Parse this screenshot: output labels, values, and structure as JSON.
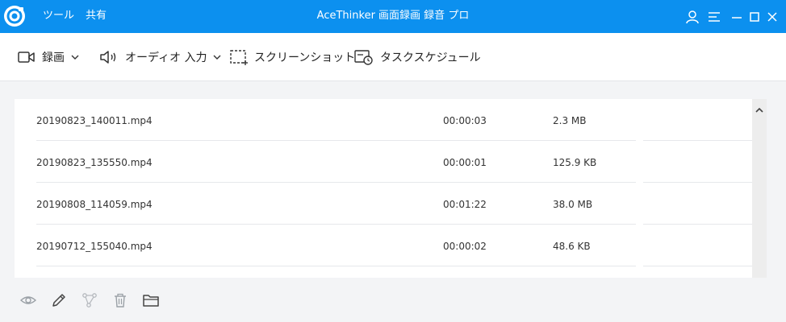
{
  "titlebar": {
    "menu": [
      "ツール",
      "共有"
    ],
    "title": "AceThinker 画面録画 録音 プロ",
    "icons": [
      "user-icon",
      "menu-icon",
      "minimize-icon",
      "maximize-icon",
      "close-icon"
    ]
  },
  "toolbar": {
    "record_label": "録画",
    "audio_label": "オーディオ 入力",
    "screenshot_label": "スクリーンショット",
    "schedule_label": "タスクスケジュール"
  },
  "files": [
    {
      "name": "20190823_140011.mp4",
      "duration": "00:00:03",
      "size": "2.3 MB"
    },
    {
      "name": "20190823_135550.mp4",
      "duration": "00:00:01",
      "size": "125.9 KB"
    },
    {
      "name": "20190808_114059.mp4",
      "duration": "00:01:22",
      "size": "38.0 MB"
    },
    {
      "name": "20190712_155040.mp4",
      "duration": "00:00:02",
      "size": "48.6 KB"
    }
  ],
  "actions": [
    "eye-icon",
    "pencil-icon",
    "share-icon",
    "trash-icon",
    "folder-icon"
  ],
  "colors": {
    "accent": "#0c90ef",
    "background": "#f3f4f6",
    "panel": "#ffffff"
  }
}
